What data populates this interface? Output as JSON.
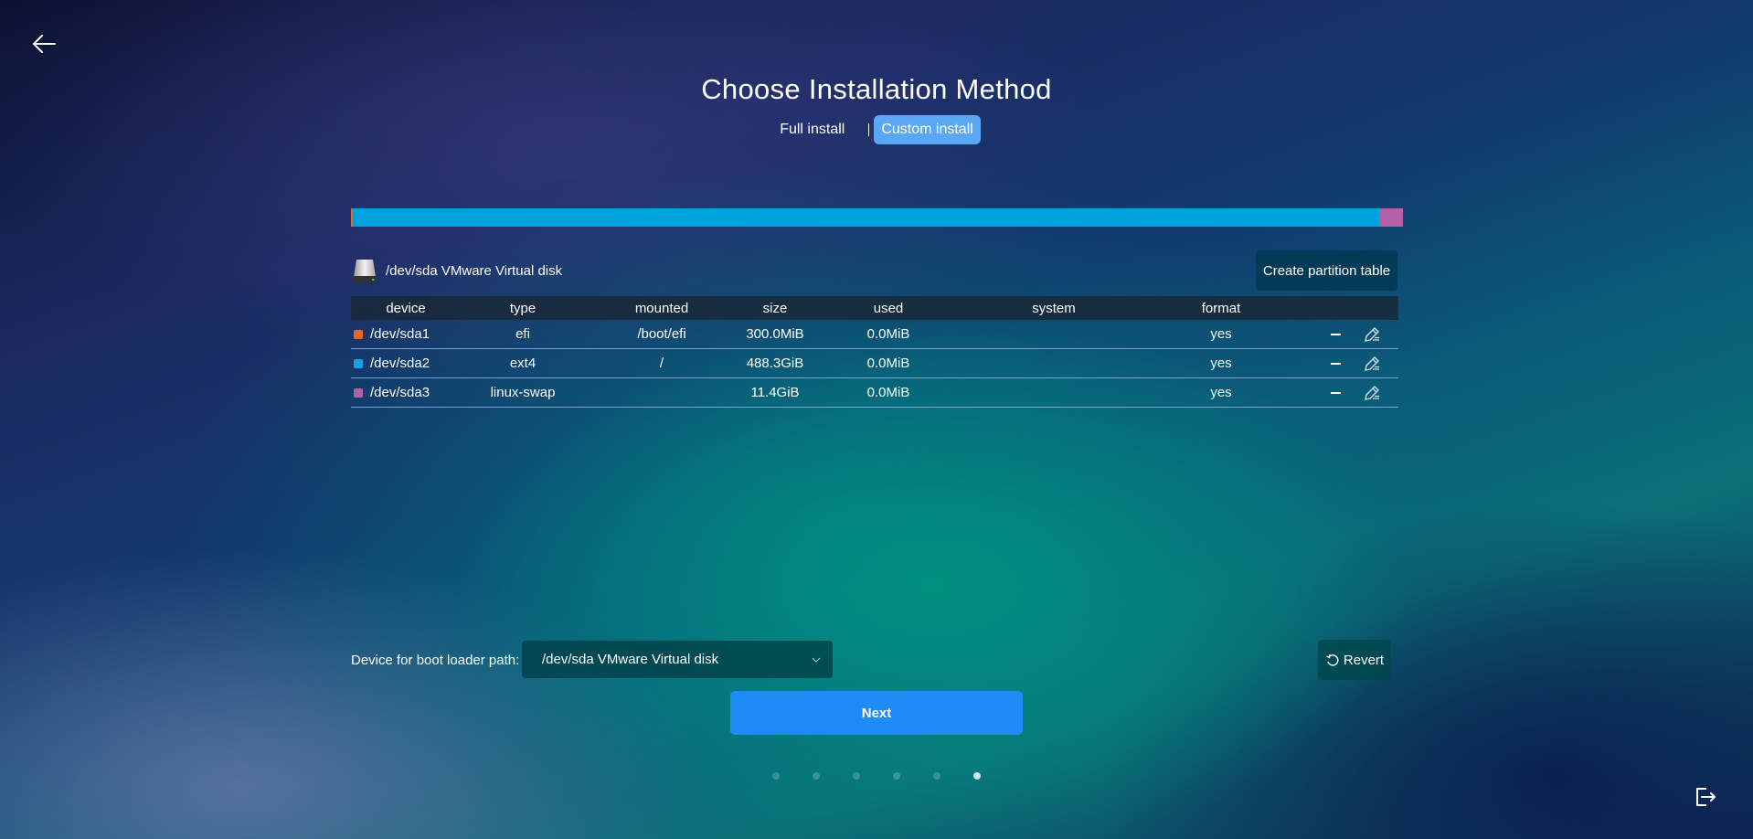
{
  "header": {
    "back_icon": "arrow-left-icon",
    "title": "Choose Installation Method",
    "tabs": [
      {
        "label": "Full install",
        "active": false
      },
      {
        "label": "Custom install",
        "active": true
      }
    ]
  },
  "partition_bar": {
    "segments": [
      {
        "device": "/dev/sda1",
        "size_gib": 0.293,
        "color": "#f0661d"
      },
      {
        "device": "/dev/sda2",
        "size_gib": 488.3,
        "color": "#00a2dd"
      },
      {
        "device": "/dev/sda3",
        "size_gib": 11.4,
        "color": "#b461a8"
      }
    ]
  },
  "disk": {
    "icon": "hard-disk-icon",
    "label": "/dev/sda VMware Virtual disk",
    "create_partition_table_label": "Create partition table"
  },
  "table": {
    "columns": [
      "device",
      "type",
      "mounted",
      "size",
      "used",
      "system",
      "format"
    ],
    "rows": [
      {
        "color": "#f0661d",
        "device": "/dev/sda1",
        "type": "efi",
        "mounted": "/boot/efi",
        "size": "300.0MiB",
        "used": "0.0MiB",
        "system": "",
        "format": "yes"
      },
      {
        "color": "#16a4e0",
        "device": "/dev/sda2",
        "type": "ext4",
        "mounted": "/",
        "size": "488.3GiB",
        "used": "0.0MiB",
        "system": "",
        "format": "yes"
      },
      {
        "color": "#b461a8",
        "device": "/dev/sda3",
        "type": "linux-swap",
        "mounted": "",
        "size": "11.4GiB",
        "used": "0.0MiB",
        "system": "",
        "format": "yes"
      }
    ],
    "row_action_icons": [
      "minus-icon",
      "edit-pen-icon"
    ]
  },
  "bootloader": {
    "label": "Device for boot loader path:",
    "selected": "/dev/sda VMware Virtual disk"
  },
  "buttons": {
    "revert": "Revert",
    "next": "Next"
  },
  "pager": {
    "total": 6,
    "current": 6
  },
  "footer": {
    "exit_icon": "exit-icon"
  }
}
